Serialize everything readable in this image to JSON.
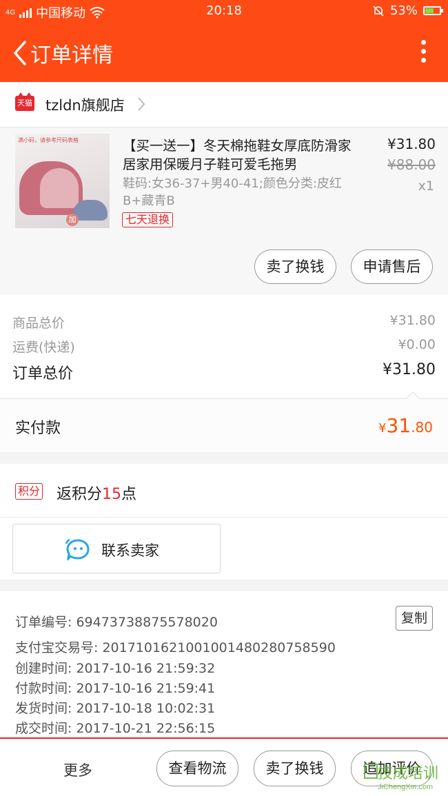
{
  "status_bar": {
    "network": "4G",
    "carrier": "中国移动",
    "time": "20:18",
    "battery": "53%"
  },
  "header": {
    "title": "订单详情"
  },
  "shop": {
    "badge": "天猫",
    "name": "tzldn旗舰店"
  },
  "product": {
    "title": "【买一送一】冬天棉拖鞋女厚底防滑家居家用保暖月子鞋可爱毛拖男",
    "spec": "鞋码:女36-37+男40-41;颜色分类:皮红B+藏青B",
    "return_badge": "七天退换",
    "price": "¥31.80",
    "original_price": "¥88.00",
    "quantity": "x1",
    "thumb_tag": "满小码，请参考尺码表格",
    "thumb_add": "加",
    "actions": [
      "卖了换钱",
      "申请售后"
    ]
  },
  "summary": {
    "rows": [
      {
        "label": "商品总价",
        "value": "¥31.80"
      },
      {
        "label": "运费(快递)",
        "value": "¥0.00"
      },
      {
        "label": "订单总价",
        "value": "¥31.80"
      }
    ],
    "paid_label": "实付款",
    "paid_currency": "¥",
    "paid_int": "31",
    "paid_dec": ".80"
  },
  "points": {
    "badge": "积分",
    "prefix": "返积分",
    "count": "15",
    "suffix": "点"
  },
  "contact": {
    "label": "联系卖家"
  },
  "order_info": {
    "copy_label": "复制",
    "rows": [
      "订单编号: 69473738875578020",
      "支付宝交易号: 2017101621001001480280758590",
      "创建时间: 2017-10-16 21:59:32",
      "付款时间: 2017-10-16 21:59:41",
      "发货时间: 2017-10-18 10:02:31",
      "成交时间: 2017-10-21 22:56:15"
    ]
  },
  "bottom_bar": {
    "more": "更多",
    "buttons": [
      "查看物流",
      "卖了换钱",
      "追加评价"
    ]
  },
  "watermark": {
    "text": "技成培训",
    "url": "JiChengXin.com"
  },
  "colors": {
    "brand": "#fe4a14",
    "tmall_red": "#e8262d",
    "price_orange": "#ff5000"
  }
}
